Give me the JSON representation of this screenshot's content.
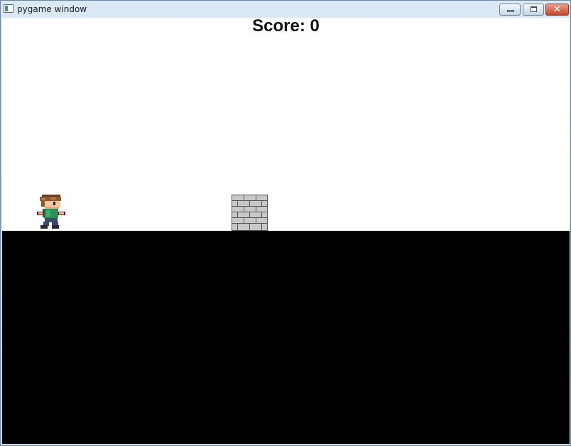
{
  "window": {
    "title": "pygame window",
    "controls": {
      "minimize": "minimize-icon",
      "maximize": "maximize-icon",
      "close": "close-icon"
    }
  },
  "hud": {
    "score_text": "Score: 0"
  },
  "scene": {
    "colors": {
      "sky": "#ffffff",
      "ground": "#000000",
      "brick": "#c8c8c8",
      "mortar": "#555555"
    },
    "sprites": [
      "player-character",
      "brick-wall-obstacle"
    ]
  }
}
